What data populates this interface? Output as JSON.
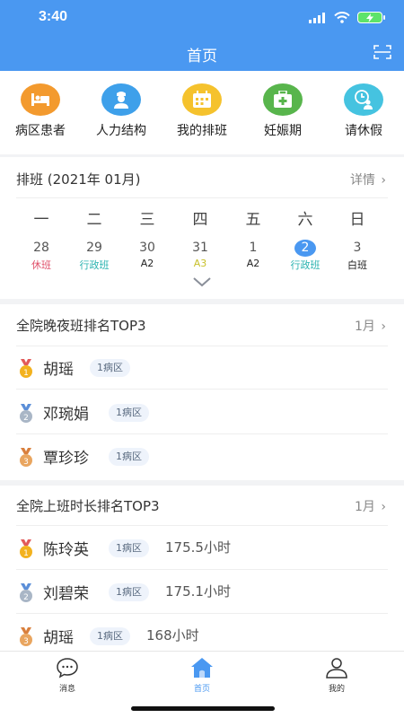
{
  "status": {
    "time": "3:40"
  },
  "header": {
    "title": "首页"
  },
  "quick_actions": [
    {
      "label": "病区患者",
      "icon": "bed-icon",
      "color": "#f39a2e"
    },
    {
      "label": "人力结构",
      "icon": "nurse-icon",
      "color": "#3ea0ea"
    },
    {
      "label": "我的排班",
      "icon": "calendar-icon",
      "color": "#f5c22d"
    },
    {
      "label": "妊娠期",
      "icon": "medical-kit-icon",
      "color": "#58b54c"
    },
    {
      "label": "请休假",
      "icon": "leave-icon",
      "color": "#45c3e0"
    }
  ],
  "schedule": {
    "title": "排班 (2021年 01月)",
    "more": "详情",
    "weekdays": [
      "一",
      "二",
      "三",
      "四",
      "五",
      "六",
      "日"
    ],
    "days": [
      {
        "num": "28",
        "shift": "休班",
        "color": "#e0506a",
        "active": false
      },
      {
        "num": "29",
        "shift": "行政班",
        "color": "#2bb3b0",
        "active": false
      },
      {
        "num": "30",
        "shift": "A2",
        "color": "#222222",
        "active": false
      },
      {
        "num": "31",
        "shift": "A3",
        "color": "#c8c02a",
        "active": false
      },
      {
        "num": "1",
        "shift": "A2",
        "color": "#222222",
        "active": false
      },
      {
        "num": "2",
        "shift": "行政班",
        "color": "#2bb3b0",
        "active": true
      },
      {
        "num": "3",
        "shift": "白班",
        "color": "#222222",
        "active": false
      }
    ]
  },
  "night_rank": {
    "title": "全院晚夜班排名TOP3",
    "more": "1月",
    "rows": [
      {
        "rank": "1",
        "name": "胡瑶",
        "dept": "1病区"
      },
      {
        "rank": "2",
        "name": "邓琬娟",
        "dept": "1病区"
      },
      {
        "rank": "3",
        "name": "覃珍珍",
        "dept": "1病区"
      }
    ]
  },
  "hours_rank": {
    "title": "全院上班时长排名TOP3",
    "more": "1月",
    "rows": [
      {
        "rank": "1",
        "name": "陈玲英",
        "dept": "1病区",
        "hours": "175.5小时"
      },
      {
        "rank": "2",
        "name": "刘碧荣",
        "dept": "1病区",
        "hours": "175.1小时"
      },
      {
        "rank": "3",
        "name": "胡瑶",
        "dept": "1病区",
        "hours": "168小时"
      }
    ]
  },
  "tabs": [
    {
      "label": "消息",
      "icon": "message-icon",
      "active": false
    },
    {
      "label": "首页",
      "icon": "home-icon",
      "active": true
    },
    {
      "label": "我的",
      "icon": "profile-icon",
      "active": false
    }
  ],
  "theme": {
    "primary": "#4a98f1",
    "gold": "#f3b21e",
    "silver": "#a9b6c6",
    "bronze": "#e9a55f"
  }
}
